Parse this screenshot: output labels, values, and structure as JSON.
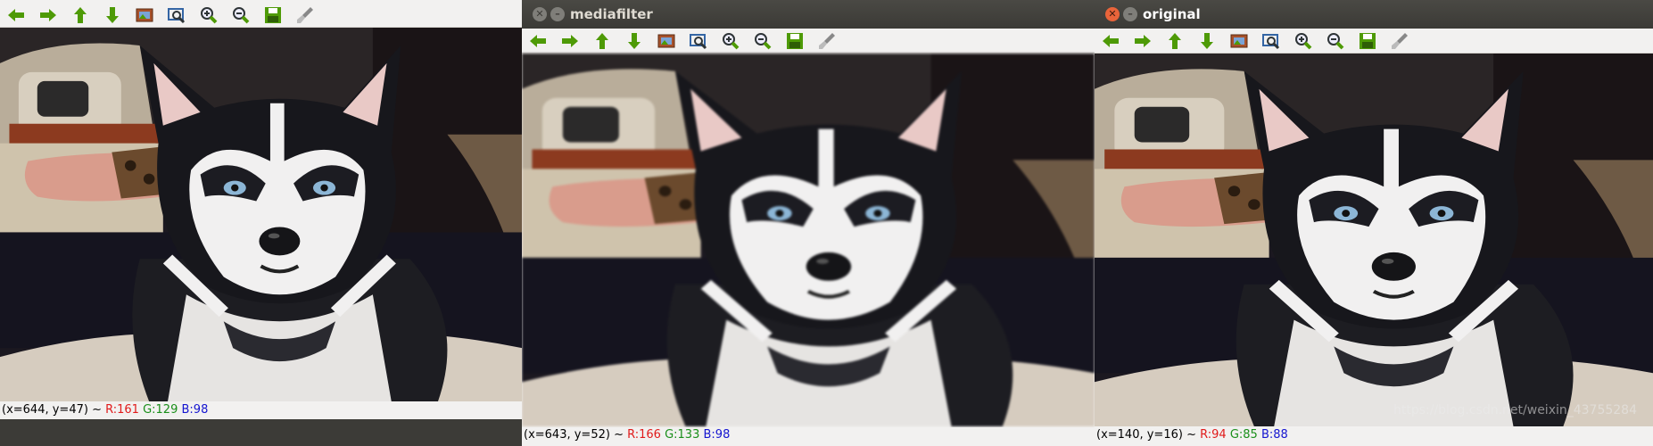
{
  "windows": [
    {
      "id": "left",
      "title": "",
      "status": {
        "coords": "(x=644, y=47) ~",
        "r": "R:161",
        "g": "G:129",
        "b": "B:98"
      }
    },
    {
      "id": "middle",
      "title": "mediafilter",
      "status": {
        "coords": "(x=643, y=52) ~",
        "r": "R:166",
        "g": "G:133",
        "b": "B:98"
      }
    },
    {
      "id": "right",
      "title": "original",
      "status": {
        "coords": "(x=140, y=16) ~",
        "r": "R:94",
        "g": "G:85",
        "b": "B:88"
      }
    }
  ],
  "toolbar_icons": [
    "pan-left-icon",
    "pan-right-icon",
    "pan-up-icon",
    "pan-down-icon",
    "zoom-fit-icon",
    "zoom-area-icon",
    "zoom-in-icon",
    "zoom-out-icon",
    "save-icon",
    "properties-brush-icon"
  ],
  "watermark": "https://blog.csdn.net/weixin_43755284",
  "colors": {
    "titlebar": "#3c3b37",
    "toolbar": "#f2f1f0",
    "close_active": "#e9643a",
    "arrow_green": "#4e9a06"
  }
}
